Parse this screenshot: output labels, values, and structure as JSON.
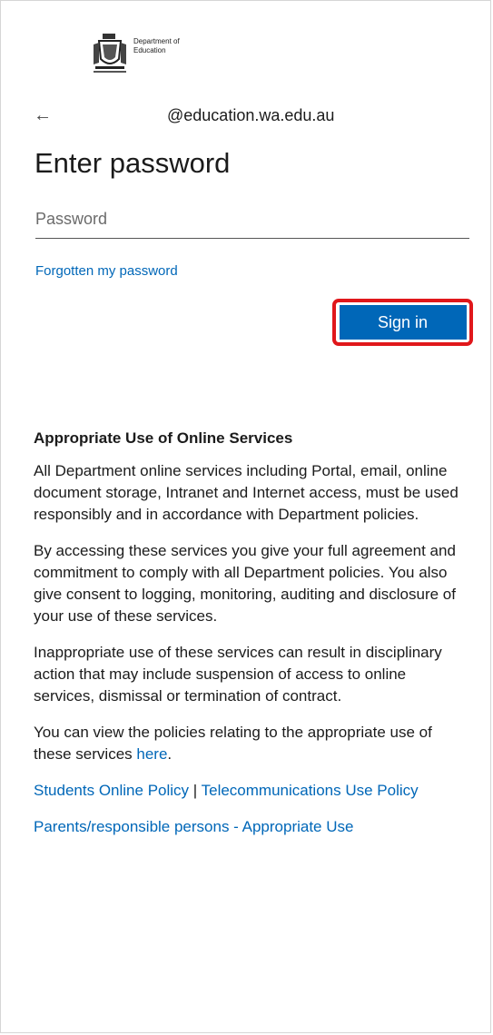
{
  "logo": {
    "name": "department-of-education-logo",
    "text_line1": "Department of",
    "text_line2": "Education"
  },
  "identity": {
    "back_icon": "arrow-left-icon",
    "back_glyph": "←",
    "email": "@education.wa.edu.au"
  },
  "title": "Enter password",
  "password": {
    "placeholder": "Password",
    "value": ""
  },
  "forgot_link": "Forgotten my password",
  "signin_button": "Sign in",
  "colors": {
    "accent": "#0067b8",
    "highlight": "#e0171b"
  },
  "aup": {
    "heading": "Appropriate Use of Online Services",
    "para1": "All Department online services including Portal, email, online document storage, Intranet and Internet access, must be used responsibly and in accordance with Department policies.",
    "para2": "By accessing these services you give your full agreement and commitment to comply with all Department policies. You also give consent to logging, monitoring, auditing and disclosure of your use of these services.",
    "para3": "Inappropriate use of these services can result in disciplinary action that may include suspension of access to online services, dismissal or termination of contract.",
    "para4_prefix": "You can view the policies relating to the appropriate use of these services ",
    "para4_link": "here",
    "para4_suffix": ".",
    "policy_link1": "Students Online Policy",
    "policy_separator": " | ",
    "policy_link2": "Telecommunications Use Policy",
    "parents_link": "Parents/responsible persons - Appropriate Use"
  }
}
